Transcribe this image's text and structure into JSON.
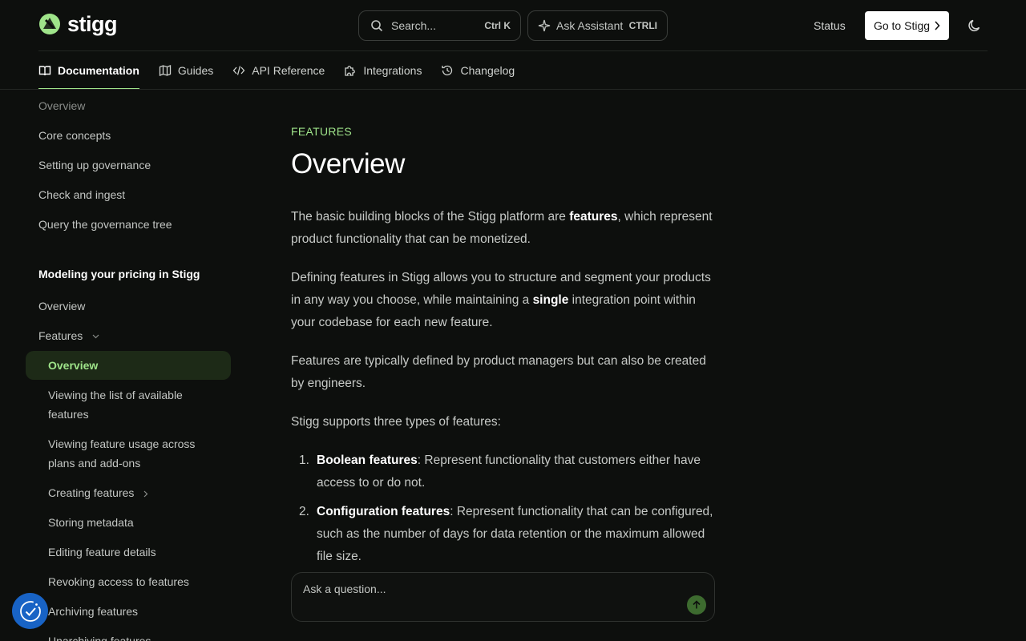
{
  "header": {
    "brand": "stigg",
    "search": {
      "placeholder": "Search...",
      "shortcut": "Ctrl K"
    },
    "assistant": {
      "label": "Ask Assistant",
      "shortcut": "CTRLI"
    },
    "status_label": "Status",
    "goto_label": "Go to Stigg"
  },
  "nav": {
    "tabs": [
      {
        "label": "Documentation",
        "icon": "book-icon",
        "active": true
      },
      {
        "label": "Guides",
        "icon": "map-icon",
        "active": false
      },
      {
        "label": "API Reference",
        "icon": "code-icon",
        "active": false
      },
      {
        "label": "Integrations",
        "icon": "puzzle-icon",
        "active": false
      },
      {
        "label": "Changelog",
        "icon": "history-icon",
        "active": false
      }
    ]
  },
  "sidebar": {
    "top_items": [
      "Overview",
      "Core concepts",
      "Setting up governance",
      "Check and ingest",
      "Query the governance tree"
    ],
    "section_heading": "Modeling your pricing in Stigg",
    "section_items": [
      "Overview",
      "Features"
    ],
    "active_item": "Overview",
    "sub_items": [
      "Viewing the list of available features",
      "Viewing feature usage across plans and add-ons",
      "Creating features",
      "Storing metadata",
      "Editing feature details",
      "Revoking access to features",
      "Archiving features",
      "Unarchiving features"
    ]
  },
  "main": {
    "eyebrow": "FEATURES",
    "title": "Overview",
    "p1": {
      "a": "The basic building blocks of the Stigg platform are ",
      "b": "features",
      "c": ", which represent product functionality that can be monetized."
    },
    "p2": {
      "a": "Defining features in Stigg allows you to structure and segment your products in any way you choose, while maintaining a ",
      "b": "single",
      "c": " integration point within your codebase for each new feature."
    },
    "p3": "Features are typically defined by product managers but can also be created by engineers.",
    "p4": "Stigg supports three types of features:",
    "list": [
      {
        "num": "1.",
        "term": "Boolean features",
        "desc": ": Represent functionality that customers either have access to or do not."
      },
      {
        "num": "2.",
        "term": "Configuration features",
        "desc": ": Represent functionality that can be configured, such as the number of days for data retention or the maximum allowed file size."
      }
    ]
  },
  "ask": {
    "placeholder": "Ask a question..."
  },
  "colors": {
    "accent": "#9fe48a",
    "background": "#0d0f0d",
    "consent": "#1863c5"
  }
}
